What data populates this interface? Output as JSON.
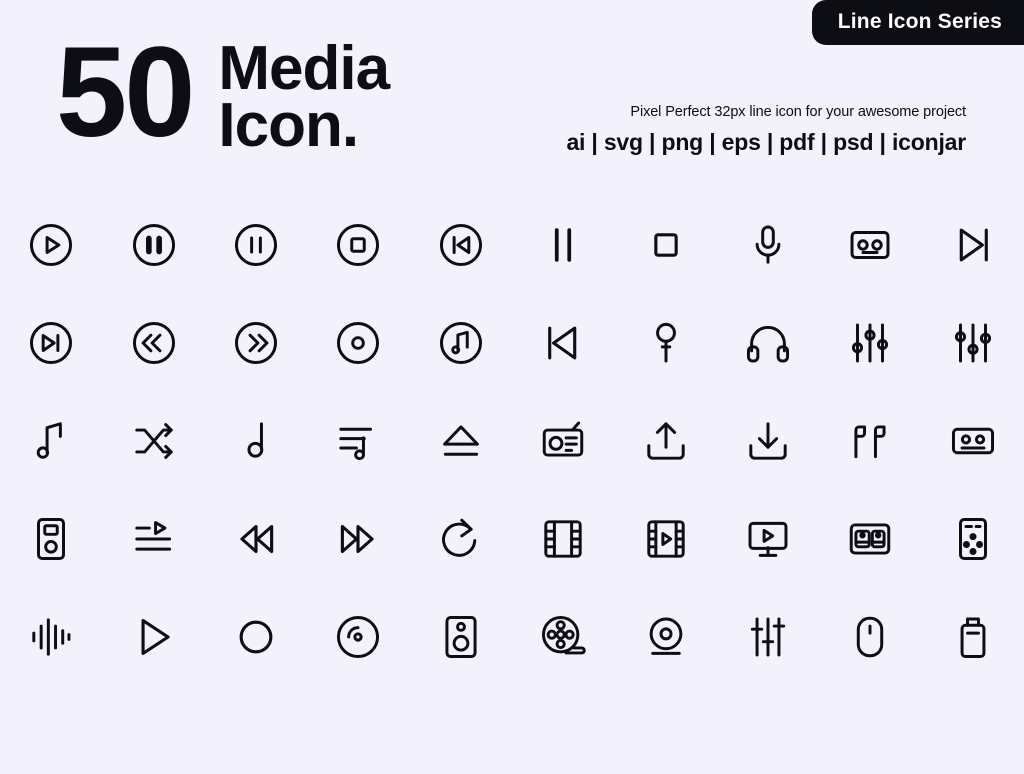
{
  "badge": {
    "label": "Line Icon Series"
  },
  "header": {
    "count": "50",
    "title_line1": "Media",
    "title_line2": "Icon.",
    "tagline": "Pixel Perfect 32px line icon for your awesome project",
    "formats": "ai | svg | png | eps | pdf | psd | iconjar"
  },
  "colors": {
    "background": "#f3f1fb",
    "ink": "#0d0d14",
    "badge_bg": "#0d0d14",
    "badge_text": "#ffffff"
  },
  "icons": [
    {
      "name": "play-circle-icon"
    },
    {
      "name": "pause-circle-filled-icon"
    },
    {
      "name": "pause-circle-icon"
    },
    {
      "name": "stop-circle-icon"
    },
    {
      "name": "rewind-circle-icon"
    },
    {
      "name": "pause-icon"
    },
    {
      "name": "stop-square-icon"
    },
    {
      "name": "microphone-icon"
    },
    {
      "name": "cassette-tape-icon"
    },
    {
      "name": "skip-forward-icon"
    },
    {
      "name": "next-track-circle-icon"
    },
    {
      "name": "rewind-double-circle-icon"
    },
    {
      "name": "fast-forward-double-circle-icon"
    },
    {
      "name": "record-disc-circle-icon"
    },
    {
      "name": "music-note-circle-icon"
    },
    {
      "name": "previous-track-icon"
    },
    {
      "name": "handheld-microphone-icon"
    },
    {
      "name": "headphones-icon"
    },
    {
      "name": "equalizer-sliders-icon"
    },
    {
      "name": "equalizer-sliders-alt-icon"
    },
    {
      "name": "music-note-icon"
    },
    {
      "name": "shuffle-icon"
    },
    {
      "name": "eighth-note-icon"
    },
    {
      "name": "playlist-music-icon"
    },
    {
      "name": "eject-icon"
    },
    {
      "name": "radio-icon"
    },
    {
      "name": "upload-icon"
    },
    {
      "name": "download-icon"
    },
    {
      "name": "earbuds-icon"
    },
    {
      "name": "tape-reel-icon"
    },
    {
      "name": "mp3-player-icon"
    },
    {
      "name": "playlist-play-icon"
    },
    {
      "name": "rewind-icon"
    },
    {
      "name": "fast-forward-icon"
    },
    {
      "name": "repeat-refresh-icon"
    },
    {
      "name": "film-strip-icon"
    },
    {
      "name": "video-play-film-icon"
    },
    {
      "name": "video-add-icon"
    },
    {
      "name": "boombox-icon"
    },
    {
      "name": "remote-control-icon"
    },
    {
      "name": "sound-wave-icon"
    },
    {
      "name": "play-triangle-icon"
    },
    {
      "name": "record-circle-icon"
    },
    {
      "name": "compact-disc-icon"
    },
    {
      "name": "speaker-icon"
    },
    {
      "name": "film-reel-icon"
    },
    {
      "name": "webcam-icon"
    },
    {
      "name": "mixer-sliders-icon"
    },
    {
      "name": "computer-mouse-icon"
    },
    {
      "name": "usb-flash-drive-icon"
    }
  ]
}
